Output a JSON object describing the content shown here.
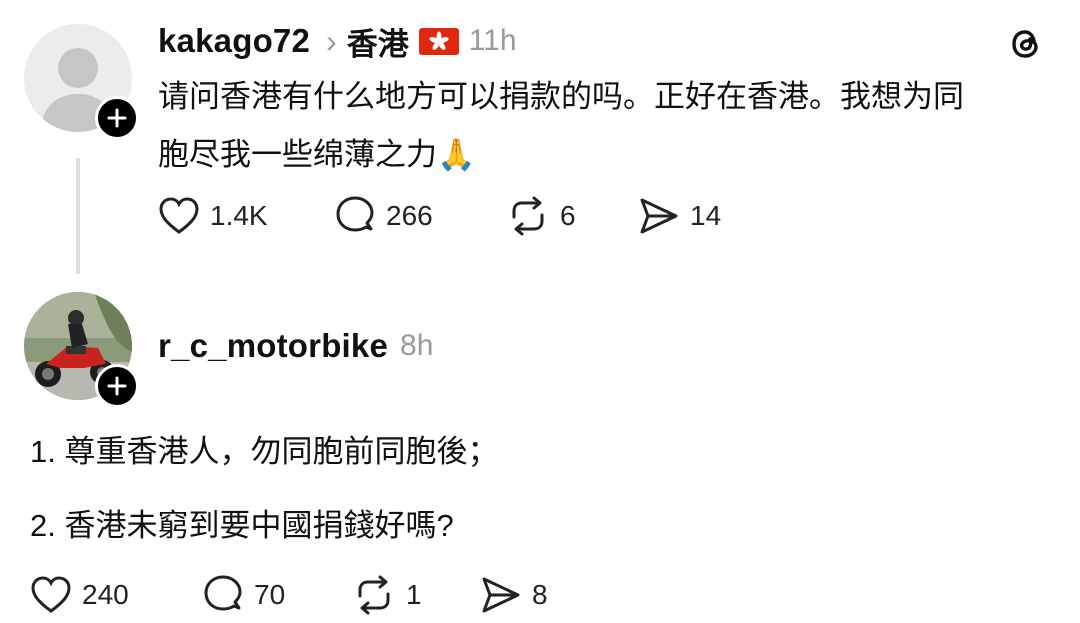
{
  "post1": {
    "username": "kakago72",
    "location_chevron": "›",
    "location": "香港",
    "flag": "🇭🇰",
    "time": "11h",
    "app_icon": "threads-logo-icon",
    "text_line1": "请问香港有什么地方可以捐款的吗。正好在香港。我想为同",
    "text_line2": "胞尽我一些绵薄之力🙏",
    "actions": {
      "likes": "1.4K",
      "replies": "266",
      "reposts": "6",
      "shares": "14"
    }
  },
  "post2": {
    "username": "r_c_motorbike",
    "time": "8h",
    "line1": "1. 尊重香港人，勿同胞前同胞後；",
    "line2": "2. 香港未窮到要中國捐錢好嗎?",
    "actions": {
      "likes": "240",
      "replies": "70",
      "reposts": "1",
      "shares": "8"
    }
  },
  "colors": {
    "meta_gray": "#9a9a9a",
    "hk_flag_red": "#de2910",
    "badge_black": "#000000"
  }
}
